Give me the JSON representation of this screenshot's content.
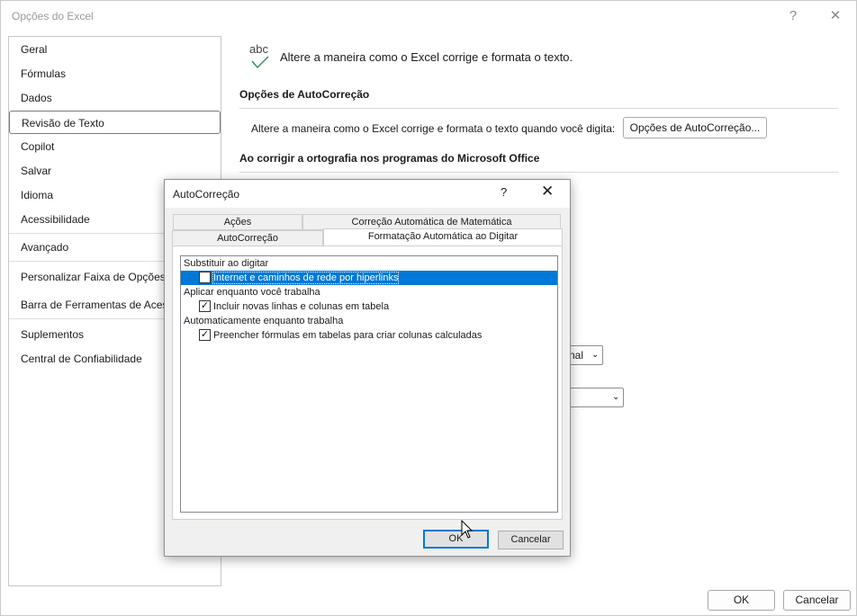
{
  "window": {
    "title": "Opções do Excel",
    "help_glyph": "?",
    "close_glyph": "✕"
  },
  "nav": {
    "items": [
      {
        "label": "Geral"
      },
      {
        "label": "Fórmulas"
      },
      {
        "label": "Dados"
      },
      {
        "label": "Revisão de Texto",
        "selected": true
      },
      {
        "label": "Copilot"
      },
      {
        "label": "Salvar"
      },
      {
        "label": "Idioma"
      },
      {
        "label": "Acessibilidade"
      },
      {
        "label": "Avançado"
      },
      {
        "label": "Personalizar Faixa de Opções"
      },
      {
        "label": "Barra de Ferramentas de Acesso Rápido"
      },
      {
        "label": "Suplementos"
      },
      {
        "label": "Central de Confiabilidade"
      }
    ]
  },
  "main": {
    "icon_text": "abc",
    "header_desc": "Altere a maneira como o Excel corrige e formata o texto.",
    "autocorrect_section": {
      "title": "Opções de AutoCorreção",
      "desc": "Altere a maneira como o Excel corrige e formata o texto quando você digita:",
      "button_label": "Opções de AutoCorreção..."
    },
    "spelling_section": {
      "title": "Ao corrigir a ortografia nos programas do Microsoft Office"
    },
    "partial_select_1": "nal",
    "ok_label": "OK",
    "cancel_label": "Cancelar"
  },
  "dialog": {
    "title": "AutoCorreção",
    "help_glyph": "?",
    "close_glyph": "✕",
    "tabs_top": [
      {
        "label": "Ações"
      },
      {
        "label": "Correção Automática de Matemática"
      }
    ],
    "tabs_bottom": [
      {
        "label": "AutoCorreção"
      },
      {
        "label": "Formatação Automática ao Digitar",
        "active": true
      }
    ],
    "list": {
      "groups": [
        {
          "label": "Substituir ao digitar",
          "items": [
            {
              "label": "Internet e caminhos de rede por hiperlinks",
              "checked": false,
              "selected": true
            }
          ]
        },
        {
          "label": "Aplicar enquanto você trabalha",
          "items": [
            {
              "label": "Incluir novas linhas e colunas em tabela",
              "checked": true
            }
          ]
        },
        {
          "label": "Automaticamente enquanto trabalha",
          "items": [
            {
              "label": "Preencher fórmulas em tabelas  para criar colunas calculadas",
              "checked": true
            }
          ]
        }
      ]
    },
    "ok_label": "OK",
    "cancel_label": "Cancelar",
    "check_glyph": "✓"
  }
}
